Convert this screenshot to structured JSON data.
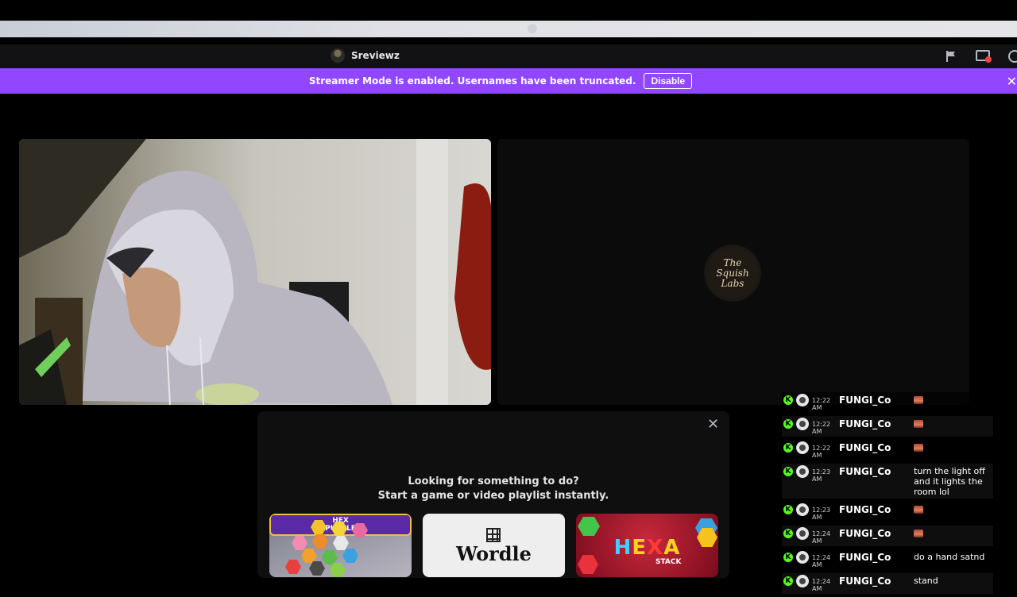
{
  "window": {
    "title": "Sreviewz"
  },
  "banner": {
    "message": "Streamer Mode is enabled. Usernames have been truncated.",
    "disable_label": "Disable",
    "color": "#9147ff"
  },
  "activity": {
    "heading_line1": "Looking for something to do?",
    "heading_line2": "Start a game or video playlist instantly.",
    "cards": [
      {
        "name": "Hex Puzzle",
        "badge_line1": "HEX",
        "badge_line2": "PUZZLE"
      },
      {
        "name": "Wordle",
        "title": "Wordle"
      },
      {
        "name": "Hexa Stack",
        "title_letters": [
          "H",
          "E",
          "X",
          "A"
        ],
        "subtitle": "STACK"
      }
    ]
  },
  "logo": {
    "lines": [
      "The",
      "Squish",
      "Labs"
    ]
  },
  "chat": {
    "messages": [
      {
        "time": "12:22 AM",
        "user": "FUNGI_Co",
        "text": "",
        "emote": true
      },
      {
        "time": "12:22 AM",
        "user": "FUNGI_Co",
        "text": "",
        "emote": true
      },
      {
        "time": "12:22 AM",
        "user": "FUNGI_Co",
        "text": "",
        "emote": true
      },
      {
        "time": "12:23 AM",
        "user": "FUNGI_Co",
        "text": "turn the light off and it lights the room lol",
        "emote": false
      },
      {
        "time": "12:23 AM",
        "user": "FUNGI_Co",
        "text": "",
        "emote": true
      },
      {
        "time": "12:24 AM",
        "user": "FUNGI_Co",
        "text": "",
        "emote": true
      },
      {
        "time": "12:24 AM",
        "user": "FUNGI_Co",
        "text": "do a hand satnd",
        "emote": false
      },
      {
        "time": "12:24 AM",
        "user": "FUNGI_Co",
        "text": "stand",
        "emote": false
      }
    ],
    "badge_color": "#53fc18"
  },
  "icons": {
    "flag": "flag-icon",
    "screen": "screen-share-icon",
    "help": "help-icon",
    "close": "close-icon"
  }
}
